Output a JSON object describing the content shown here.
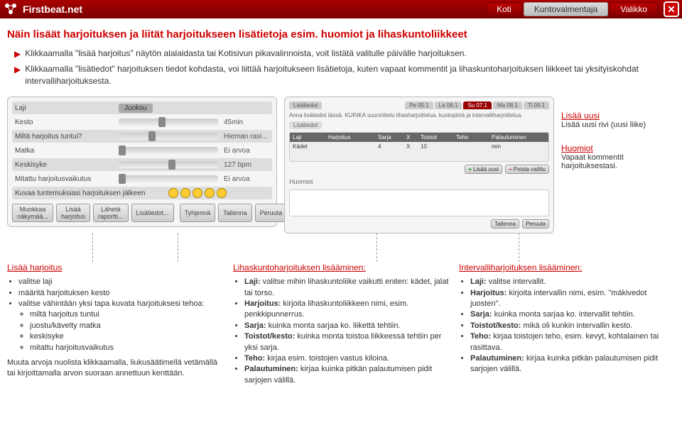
{
  "header": {
    "brand": "Firstbeat.net",
    "nav": {
      "home": "Koti",
      "coach": "Kuntovalmentaja",
      "menu": "Valikko"
    }
  },
  "title": "Näin lisäät harjoituksen ja liität harjoitukseen lisätietoja esim. huomiot ja lihaskuntoliikkeet",
  "bullets": {
    "b1": "Klikkaamalla \"lisää harjoitus\" näytön alalaidasta tai Kotisivun pikavalinnoista, voit listätä valitulle päivälle harjoituksen.",
    "b2": "Klikkaamalla \"lisätiedot\" harjoituksen tiedot kohdasta, voi liittää harjoitukseen lisätietoja, kuten vapaat kommentit ja lihaskuntoharjoituksen liikkeet tai yksityiskohdat intervalliharjoituksesta."
  },
  "leftPanel": {
    "labels": {
      "laji": "Laji",
      "kesto": "Kesto",
      "tuntui": "Miltä harjoitus tuntui?",
      "matka": "Matka",
      "keskisyke": "Keskisyke",
      "mitattu": "Mitattu harjoitusvaikutus",
      "kuvaa": "Kuvaa tuntemuksiasi harjoituksen jälkeen"
    },
    "values": {
      "laji": "Juoksu",
      "kesto": "45min",
      "tuntui": "Hieman rasi...",
      "matka": "Ei arvoa",
      "keskisyke": "127 bpm",
      "mitattu": "Ei arvoa"
    },
    "buttons": {
      "muokkaa": "Muokkaa näkymää...",
      "lisaa": "Lisää harjoitus",
      "raportti": "Lähetä raportti...",
      "lisatiedot": "Lisätiedot...",
      "tyhjenna": "Tyhjennä",
      "tallenna": "Tallenna",
      "peruuta": "Peruuta"
    }
  },
  "rightPanel": {
    "header": "Lisätiedot",
    "desc": "Anna lisätiedot tässä. KUINKA suunnittelu lihasharjoittelua, kuntopiiriä ja intervalliharjoittelua.",
    "subHeader": "Lisätiedot",
    "table": {
      "cols": {
        "laji": "Laji",
        "harjoitus": "Harjoitus",
        "sarja": "Sarja",
        "x": "X",
        "toistot": "Toistot",
        "teho": "Teho",
        "palautuminen": "Palautuminen"
      },
      "row": {
        "laji": "Kädet",
        "sarja": "4",
        "x": "X",
        "toistot": "10",
        "palautuminen": "min"
      }
    },
    "buttons": {
      "lisaauusi": "Lisää uusi",
      "poista": "Poista valittu",
      "tallenna": "Tallenna",
      "peruuta": "Peruuta"
    },
    "huomiotLabel": "Huomiot"
  },
  "callouts": {
    "c1": {
      "title": "Lisää uusi",
      "text": "Lisää uusi rivi (uusi liike)"
    },
    "c2": {
      "title": "Huomiot",
      "text": "Vapaat kommentit harjoituksestasi."
    }
  },
  "bottom": {
    "col1": {
      "title": "Lisää harjoitus",
      "li1": "valitse laji",
      "li2": "määritä harjoituksen kesto",
      "li3": "valitse vähintään yksi tapa kuvata harjoituksesi tehoa:",
      "li3a": "miltä harjoitus tuntui",
      "li3b": "juostu/kävelty matka",
      "li3c": "keskisyke",
      "li3d": "mitattu harjoitusvaikutus",
      "para": "Muuta arvoja nuolista klikkaamalla, liukusäätimellä vetämällä tai kirjoittamalla arvon suoraan annettuun kenttään."
    },
    "col2": {
      "title": "Lihaskuntoharjoituksen lisääminen:",
      "li1": "Laji: valitse mihin lihaskuntoliike vaikutti eniten: kädet, jalat tai torso.",
      "li2": "Harjoitus: kirjoita lihaskuntoliikkeen nimi, esim. penkkipunnerrus.",
      "li3": "Sarja: kuinka monta sarjaa ko. liikettä tehtiin.",
      "li4": "Toistot/kesto: kuinka monta toistoa liikkeessä tehtiin per yksi sarja.",
      "li5": "Teho: kirjaa esim. toistojen vastus kiloina.",
      "li6": "Palautuminen: kirjaa kuinka pitkän palautumisen pidit sarjojen välillä."
    },
    "col3": {
      "title": "Intervalliharjoituksen lisääminen:",
      "li1": "Laji: valitse intervallit.",
      "li2": "Harjoitus: kirjoita intervallin nimi, esim. \"mäkivedot juosten\".",
      "li3": "Sarja: kuinka monta sarjaa ko. intervallit tehtiin.",
      "li4": "Toistot/kesto: mikä oli kunkin intervallin kesto.",
      "li5": "Teho: kirjaa toistojen teho, esim. kevyt, kohtalainen tai rasittava.",
      "li6": "Palautuminen: kirjaa kuinka pitkän palautumisen pidit sarjojen välillä."
    }
  }
}
